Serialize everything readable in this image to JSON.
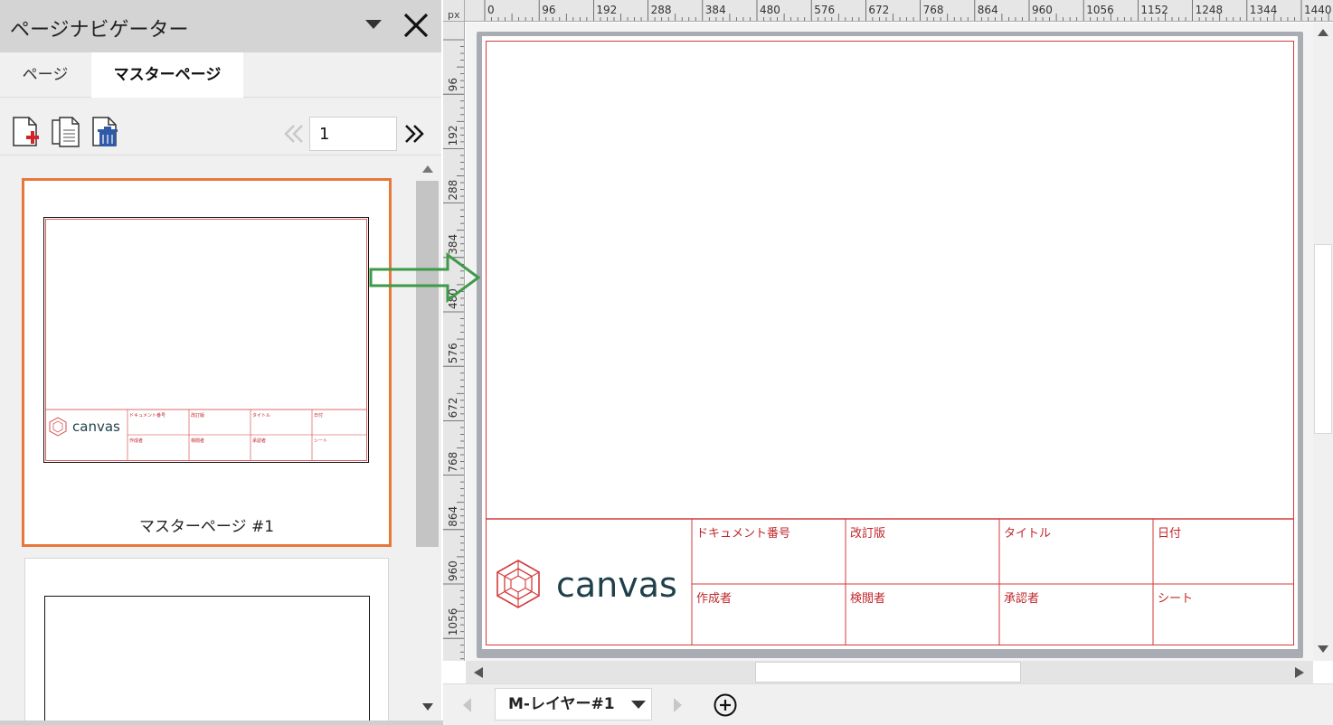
{
  "panel": {
    "title": "ページナビゲーター",
    "tabs": [
      {
        "label": "ページ",
        "active": false
      },
      {
        "label": "マスターページ",
        "active": true
      }
    ],
    "toolbar": {
      "add_icon": "add-page-icon",
      "duplicate_icon": "duplicate-page-icon",
      "delete_icon": "delete-page-icon",
      "page_number": "1"
    },
    "thumbnails": [
      {
        "label": "マスターページ #1",
        "selected": true
      },
      {
        "label": "",
        "selected": false
      }
    ],
    "accent_color": "#e8773a"
  },
  "ruler": {
    "unit": "px",
    "top_ticks": [
      "0",
      "96",
      "192",
      "288",
      "384",
      "480",
      "576",
      "672",
      "768",
      "864",
      "960",
      "1056",
      "1152",
      "1248",
      "1344",
      "1440"
    ],
    "left_ticks": [
      "96",
      "192",
      "288",
      "384",
      "480",
      "576",
      "672",
      "768",
      "864",
      "960",
      "1056"
    ]
  },
  "title_block": {
    "logo_text": "canvas",
    "fields": [
      "ドキュメント番号",
      "改訂版",
      "タイトル",
      "日付",
      "作成者",
      "検閲者",
      "承認者",
      "シート"
    ],
    "border_color": "#d43a3a",
    "logo_color": "#1f3f4a"
  },
  "layer": {
    "label": "M-レイヤー#1"
  },
  "arrow_color": "#3d9a47"
}
